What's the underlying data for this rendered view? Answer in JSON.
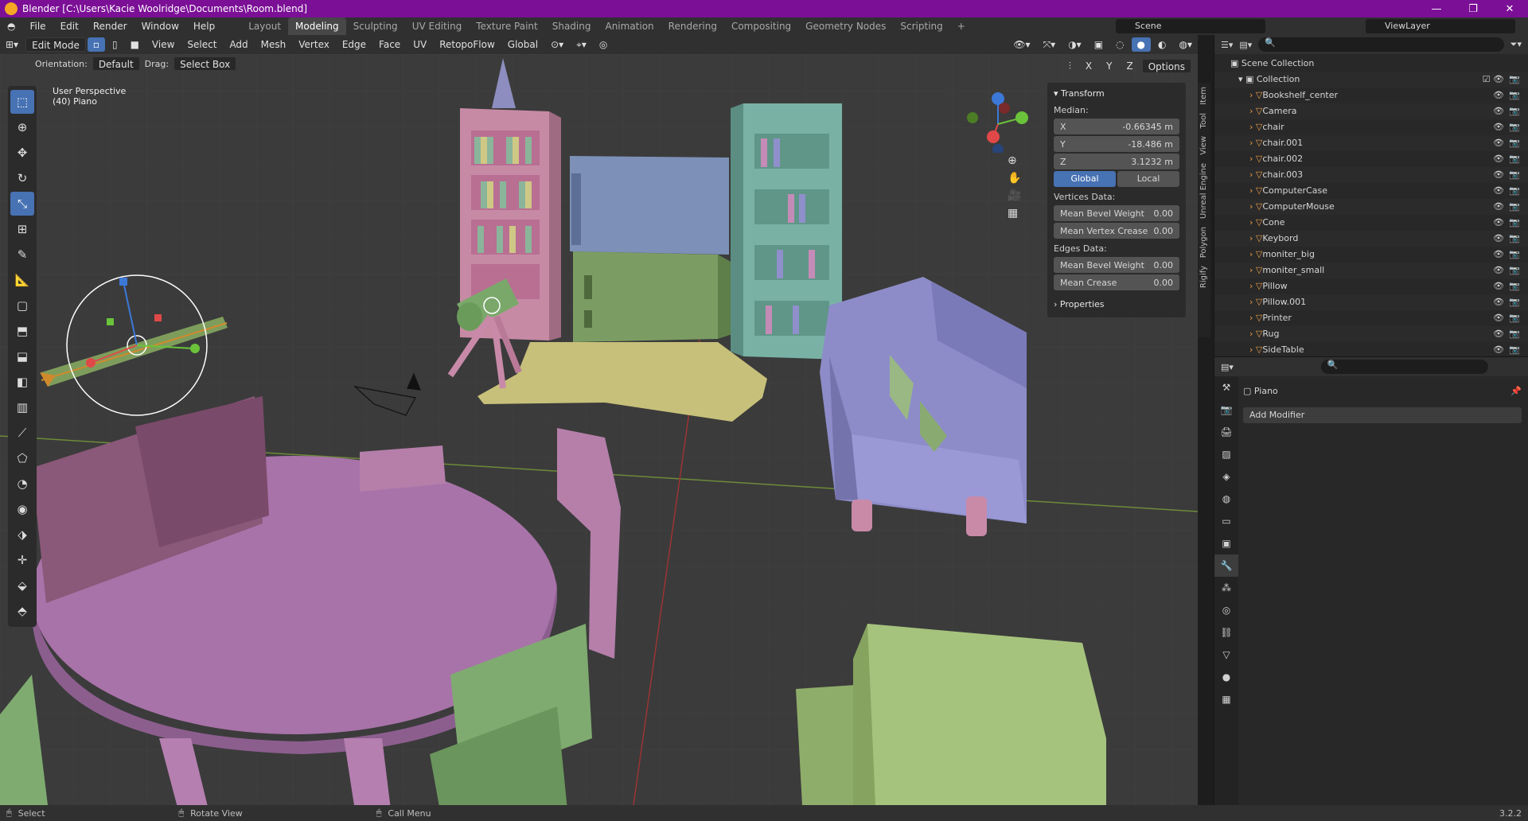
{
  "title": "Blender [C:\\Users\\Kacie Woolridge\\Documents\\Room.blend]",
  "menu": [
    "File",
    "Edit",
    "Render",
    "Window",
    "Help"
  ],
  "workspaces": [
    "Layout",
    "Modeling",
    "Sculpting",
    "UV Editing",
    "Texture Paint",
    "Shading",
    "Animation",
    "Rendering",
    "Compositing",
    "Geometry Nodes",
    "Scripting"
  ],
  "active_workspace": "Modeling",
  "scene": "Scene",
  "view_layer": "ViewLayer",
  "header": {
    "mode": "Edit Mode",
    "items": [
      "View",
      "Select",
      "Add",
      "Mesh",
      "Vertex",
      "Edge",
      "Face",
      "UV"
    ],
    "addon": "RetopoFlow",
    "transform_space": "Global",
    "axes": [
      "X",
      "Y",
      "Z"
    ],
    "options": "Options"
  },
  "subheader": {
    "orientation_label": "Orientation:",
    "orientation_value": "Default",
    "drag_label": "Drag:",
    "drag_value": "Select Box"
  },
  "viewport": {
    "perspective": "User Perspective",
    "object": "(40) Piano",
    "gizmo_axes": [
      "X",
      "Y",
      "Z"
    ]
  },
  "npanel": {
    "section": "Transform",
    "median_label": "Median:",
    "fields": [
      {
        "key": "X",
        "val": "-0.66345 m"
      },
      {
        "key": "Y",
        "val": "-18.486 m"
      },
      {
        "key": "Z",
        "val": "3.1232 m"
      }
    ],
    "space": [
      "Global",
      "Local"
    ],
    "vertices_label": "Vertices Data:",
    "vertices": [
      {
        "key": "Mean Bevel Weight",
        "val": "0.00"
      },
      {
        "key": "Mean Vertex Crease",
        "val": "0.00"
      }
    ],
    "edges_label": "Edges Data:",
    "edges": [
      {
        "key": "Mean Bevel Weight",
        "val": "0.00"
      },
      {
        "key": "Mean Crease",
        "val": "0.00"
      }
    ],
    "properties": "Properties",
    "tabs": [
      "Item",
      "Tool",
      "View",
      "Unreal Engine",
      "Polygon",
      "Rigify"
    ]
  },
  "outliner": {
    "root": "Scene Collection",
    "collection": "Collection",
    "items": [
      "Bookshelf_center",
      "Camera",
      "chair",
      "chair.001",
      "chair.002",
      "chair.003",
      "ComputerCase",
      "ComputerMouse",
      "Cone",
      "Keybord",
      "moniter_big",
      "moniter_small",
      "Pillow",
      "Pillow.001",
      "Printer",
      "Rug",
      "SideTable"
    ]
  },
  "properties": {
    "object": "Piano",
    "add_modifier": "Add Modifier"
  },
  "status": {
    "left": "Select",
    "middle": "Rotate View",
    "right": "Call Menu",
    "version": "3.2.2"
  }
}
